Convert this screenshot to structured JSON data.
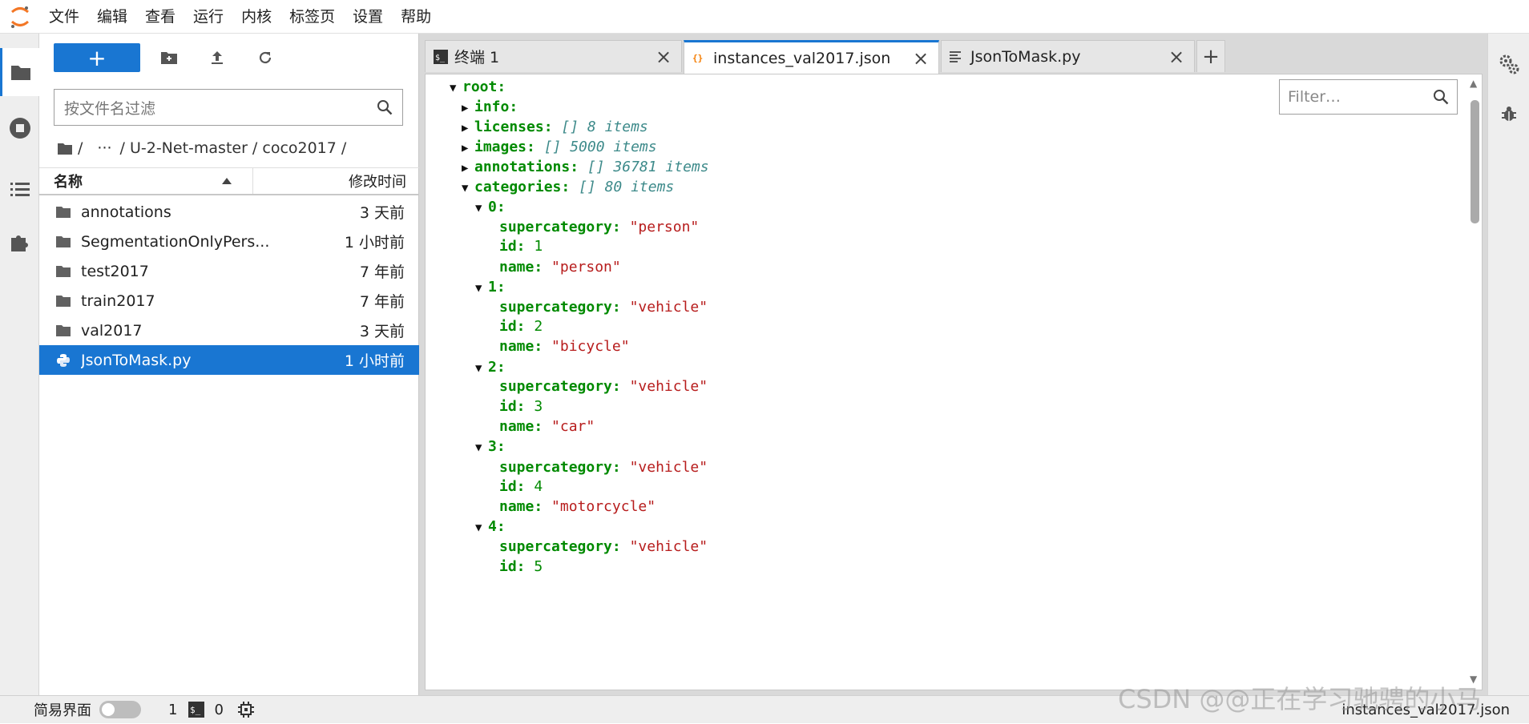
{
  "menubar": {
    "items": [
      "文件",
      "编辑",
      "查看",
      "运行",
      "内核",
      "标签页",
      "设置",
      "帮助"
    ]
  },
  "filebrowser": {
    "new_button": "+",
    "filter_placeholder": "按文件名过滤",
    "breadcrumb": [
      "/",
      "···",
      "/ U-2-Net-master / coco2017 /"
    ],
    "header_name": "名称",
    "header_modified": "修改时间",
    "files": [
      {
        "name": "annotations",
        "modified": "3 天前",
        "type": "folder"
      },
      {
        "name": "SegmentationOnlyPers...",
        "modified": "1 小时前",
        "type": "folder"
      },
      {
        "name": "test2017",
        "modified": "7 年前",
        "type": "folder"
      },
      {
        "name": "train2017",
        "modified": "7 年前",
        "type": "folder"
      },
      {
        "name": "val2017",
        "modified": "3 天前",
        "type": "folder"
      },
      {
        "name": "JsonToMask.py",
        "modified": "1 小时前",
        "type": "python",
        "selected": true
      }
    ]
  },
  "tabs": [
    {
      "label": "终端 1",
      "icon": "terminal-icon"
    },
    {
      "label": "instances_val2017.json",
      "icon": "json-icon",
      "active": true
    },
    {
      "label": "JsonToMask.py",
      "icon": "text-file-icon"
    }
  ],
  "json_viewer": {
    "filter_placeholder": "Filter…",
    "root_key": "root:",
    "collapsed": [
      {
        "key": "info:",
        "meta": ""
      },
      {
        "key": "licenses:",
        "meta": "[] 8 items"
      },
      {
        "key": "images:",
        "meta": "[] 5000 items"
      },
      {
        "key": "annotations:",
        "meta": "[] 36781 items"
      }
    ],
    "categories_key": "categories:",
    "categories_meta": "[] 80 items",
    "categories": [
      {
        "index": "0:",
        "supercategory": "\"person\"",
        "id": "1",
        "name": "\"person\""
      },
      {
        "index": "1:",
        "supercategory": "\"vehicle\"",
        "id": "2",
        "name": "\"bicycle\""
      },
      {
        "index": "2:",
        "supercategory": "\"vehicle\"",
        "id": "3",
        "name": "\"car\""
      },
      {
        "index": "3:",
        "supercategory": "\"vehicle\"",
        "id": "4",
        "name": "\"motorcycle\""
      },
      {
        "index": "4:",
        "supercategory": "\"vehicle\"",
        "id": "5",
        "name": ""
      }
    ],
    "field_labels": {
      "supercategory": "supercategory:",
      "id": "id:",
      "name": "name:"
    }
  },
  "statusbar": {
    "simple_mode": "简易界面",
    "count1": "1",
    "count2": "0",
    "current_file": "instances_val2017.json"
  },
  "watermark": "CSDN @@正在学习驰骋的小马",
  "colors": {
    "accent": "#1976d2",
    "json_key": "#008a00",
    "json_string": "#b71c1c",
    "json_meta": "#3d8a8a"
  }
}
